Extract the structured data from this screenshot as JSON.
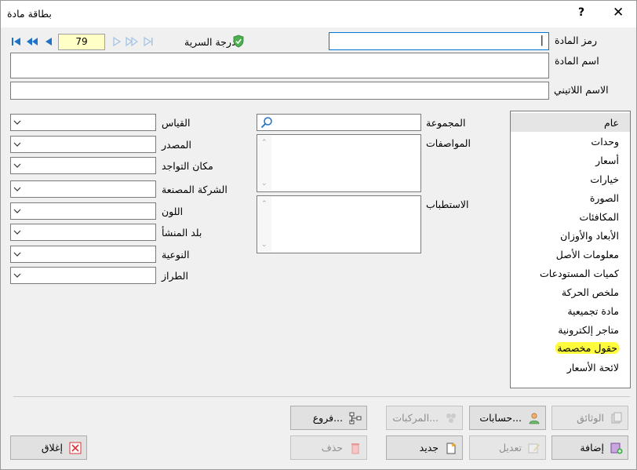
{
  "window": {
    "title": "بطاقة مادة",
    "help": "?",
    "close": "✕"
  },
  "nav": {
    "record": "79",
    "security_label": "درجة السرية"
  },
  "fields": {
    "code_label": "رمز المادة",
    "code_value": "|",
    "name_label": "اسم المادة",
    "latin_label": "الاسم اللاتيني"
  },
  "mid": {
    "group_label": "المجموعة",
    "specs_label": "المواصفات",
    "polarization_label": "الاستطباب"
  },
  "left": {
    "size": "القياس",
    "source": "المصدر",
    "location": "مكان التواجد",
    "manufacturer": "الشركة المصنعة",
    "color": "اللون",
    "origin": "بلد المنشأ",
    "quality": "النوعية",
    "model": "الطراز"
  },
  "list": {
    "items": [
      "عام",
      "وحدات",
      "أسعار",
      "خيارات",
      "الصورة",
      "المكافئات",
      "الأبعاد والأوزان",
      "معلومات الأصل",
      "كميات المستودعات",
      "ملخص الحركة",
      "مادة تجميعية",
      "متاجر إلكترونية",
      "حقول مخصصة",
      "لائحة الأسعار"
    ],
    "selected_index": 0,
    "highlighted_index": 12,
    "highlight_color": "#fffb3d"
  },
  "buttons": {
    "documents": "الوثائق",
    "accounts": "حسابات...",
    "components": "المركبات...",
    "branches": "فروع...",
    "add": "إضافة",
    "edit": "تعديل",
    "new": "جديد",
    "delete": "حذف",
    "close": "إغلاق"
  },
  "colors": {
    "nav_blue": "#1e72c8",
    "counter_bg": "#ffffc6",
    "focus_border": "#0078d7"
  }
}
